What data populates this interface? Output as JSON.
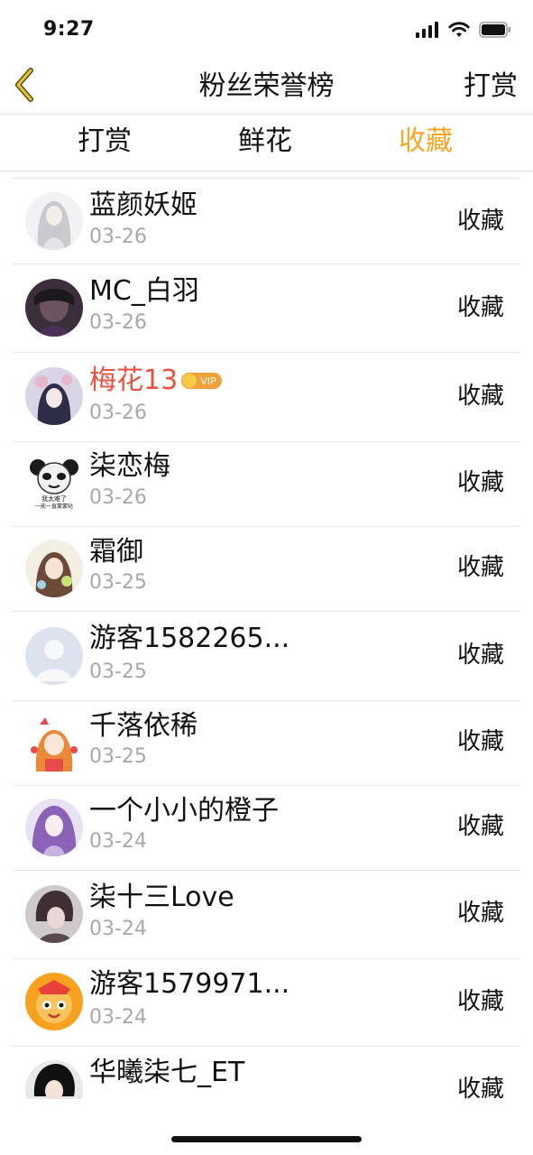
{
  "status_bar": {
    "time": "9:27"
  },
  "nav": {
    "title": "粉丝荣誉榜",
    "action_label": "打赏",
    "back_icon": "chevron-left-icon",
    "back_icon_color": "#d4a017"
  },
  "tabs": [
    {
      "label": "打赏",
      "active": false
    },
    {
      "label": "鲜花",
      "active": false
    },
    {
      "label": "收藏",
      "active": true
    }
  ],
  "accent_color": "#f5a623",
  "vip_name_color": "#e8533f",
  "rows": [
    {
      "name": "蓝颜妖姬",
      "date": "03-26",
      "action": "收藏",
      "vip": false
    },
    {
      "name": "MC_白羽",
      "date": "03-26",
      "action": "收藏",
      "vip": false
    },
    {
      "name": "梅花13",
      "date": "03-26",
      "action": "收藏",
      "vip": true,
      "badge": "VIP"
    },
    {
      "name": "柒恋梅",
      "date": "03-26",
      "action": "收藏",
      "vip": false,
      "avatar_text": [
        "我太难了",
        "一能一直蒙蒙哒"
      ]
    },
    {
      "name": "霜御",
      "date": "03-25",
      "action": "收藏",
      "vip": false
    },
    {
      "name": "游客1582265...",
      "date": "03-25",
      "action": "收藏",
      "vip": false
    },
    {
      "name": "千落依稀",
      "date": "03-25",
      "action": "收藏",
      "vip": false
    },
    {
      "name": "一个小小的橙子",
      "date": "03-24",
      "action": "收藏",
      "vip": false
    },
    {
      "name": "柒十三Love",
      "date": "03-24",
      "action": "收藏",
      "vip": false
    },
    {
      "name": "游客1579971...",
      "date": "03-24",
      "action": "收藏",
      "vip": false
    },
    {
      "name": "华曦柒七_ET",
      "date": "",
      "action": "收藏",
      "vip": false
    }
  ]
}
